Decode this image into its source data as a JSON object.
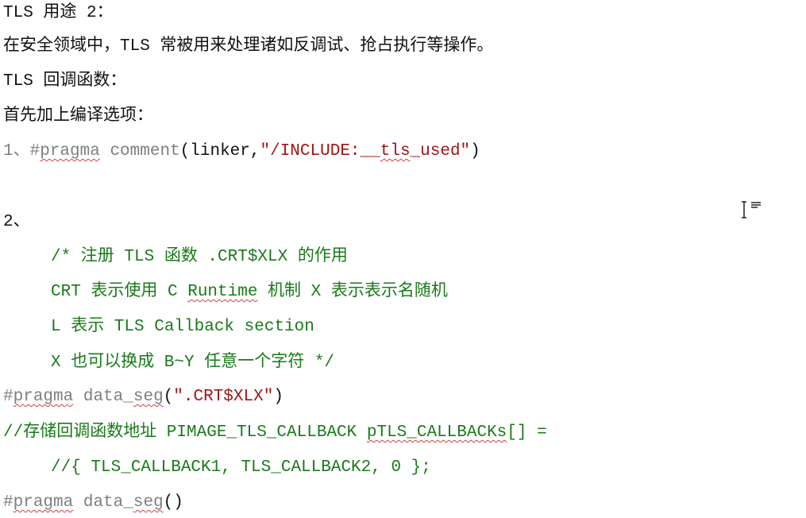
{
  "doc": {
    "l1": "TLS 用途 2：",
    "l2": "在安全领域中，TLS 常被用来处理诸如反调试、抢占执行等操作。",
    "l3": "TLS 回调函数：",
    "l4": "首先加上编译选项：",
    "l5": {
      "num": "1、",
      "hash": "#",
      "pragma": "pragma",
      "sp": " comment",
      "paren": "(linker,",
      "str1": "\"/INCLUDE:__",
      "tls": "tls",
      "str2": "_used\"",
      "close": ")"
    },
    "l6": "2、",
    "c1": "/* 注册 TLS 函数 .CRT$XLX 的作用",
    "c2a": "CRT 表示使用 C ",
    "c2b": "Runtime",
    "c2c": " 机制 X 表示表示名随机",
    "c3": "L 表示 TLS Callback section",
    "c4": "X 也可以换成 B~Y 任意一个字符 */",
    "p1": {
      "hash": "#",
      "pragma": "pragma",
      "sp": " ",
      "ds1": "data_",
      "ds2": "seg",
      "open": "(",
      "str": "\".CRT$XLX\"",
      "close": ")"
    },
    "p2": {
      "a": "//存储回调函数地址 PIMAGE_TLS_CALLBACK ",
      "b": "pTLS_CALLBACKs",
      "c": "[] ="
    },
    "p3": "//{ TLS_CALLBACK1, TLS_CALLBACK2, 0 };",
    "p4": {
      "hash": "#",
      "pragma": "pragma",
      "sp": " ",
      "ds1": "data_",
      "ds2": "seg",
      "paren": "()"
    }
  },
  "icons": {
    "cursor": "text-cursor-icon"
  },
  "colors": {
    "comment": "#1a7a1a",
    "string": "#a31515",
    "keyword": "#7f7f7f"
  }
}
